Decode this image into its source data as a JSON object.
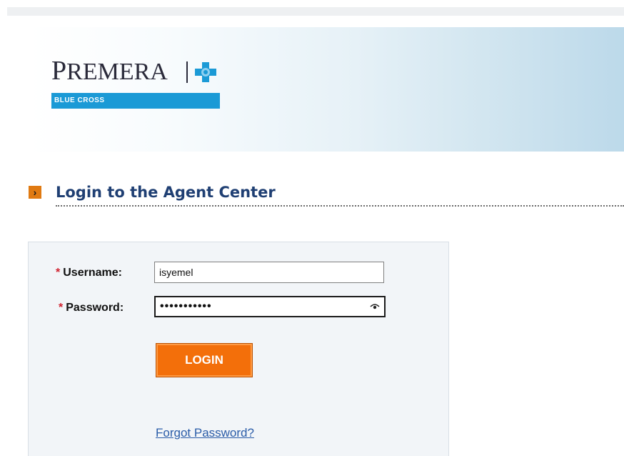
{
  "header": {
    "logo_text_first": "P",
    "logo_text_rest": "REMERA",
    "logo_tagline": "BLUE CROSS",
    "colors": {
      "brand_blue": "#1b9ad6",
      "logo_dark": "#2a2a3a"
    }
  },
  "section": {
    "title": "Login to the Agent Center",
    "arrow_icon": "chevron-right-icon",
    "title_color": "#1f3f73",
    "arrow_color": "#e07a12"
  },
  "form": {
    "username": {
      "label": "Username:",
      "required_mark": "*",
      "value": "isyemel"
    },
    "password": {
      "label": "Password:",
      "required_mark": "*",
      "masked_value": "•••••••••••",
      "reveal_icon": "eye-icon"
    },
    "login_button": {
      "label": "LOGIN",
      "color": "#f36f0a"
    },
    "forgot_link": "Forgot Password?"
  }
}
